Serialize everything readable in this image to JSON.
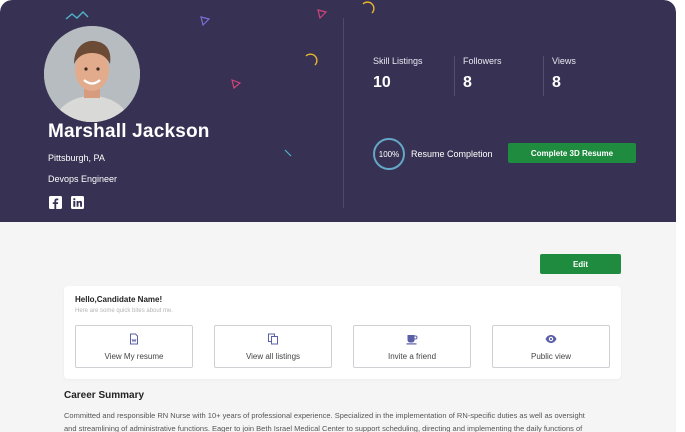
{
  "profile": {
    "name": "Marshall Jackson",
    "location": "Pittsburgh, PA",
    "role": "Devops Engineer",
    "social": [
      "facebook-icon",
      "linkedin-icon"
    ]
  },
  "stats": [
    {
      "label": "Skill Listings",
      "value": "10"
    },
    {
      "label": "Followers",
      "value": "8"
    },
    {
      "label": "Views",
      "value": "8"
    }
  ],
  "resume": {
    "completion_value": "100%",
    "completion_fraction": 1.0,
    "completion_label": "Resume Completion",
    "button_label": "Complete 3D Resume"
  },
  "actions": {
    "edit_label": "Edit"
  },
  "quick": {
    "greeting": "Hello,Candidate Name!",
    "subtitle": "Here are some quick bites about me.",
    "tiles": [
      {
        "label": "View My resume",
        "icon": "document-icon"
      },
      {
        "label": "View all listings",
        "icon": "copy-icon"
      },
      {
        "label": "Invite a friend",
        "icon": "coffee-cup-icon"
      },
      {
        "label": "Public view",
        "icon": "eye-icon"
      }
    ]
  },
  "career": {
    "title": "Career Summary",
    "line1": "Committed and responsible RN Nurse with 10+ years of professional experience. Specialized in the implementation of RN-specific duties as well as oversight",
    "line2": "and streamlining of administrative functions. Eager to join Beth Israel Medical Center to support scheduling, directing and implementing the daily functions of"
  },
  "colors": {
    "hero_bg": "#373253",
    "accent_green": "#1e8b3f",
    "ring": "#64a7c7",
    "icon_purple": "#5b5fa8"
  }
}
